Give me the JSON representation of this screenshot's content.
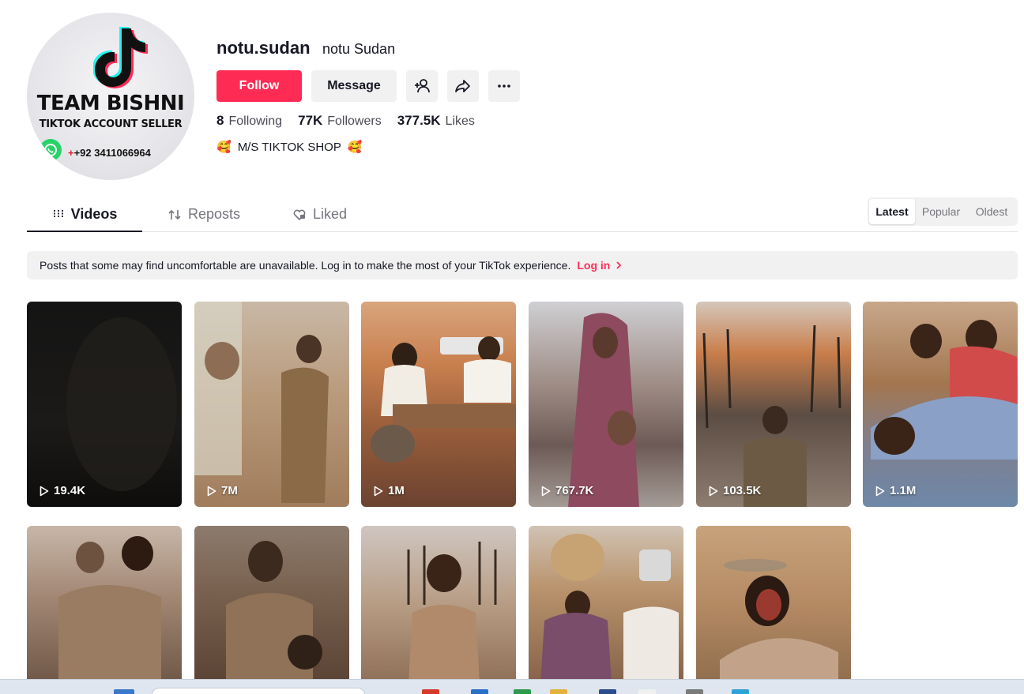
{
  "profile": {
    "username": "notu.sudan",
    "nickname": "notu Sudan",
    "avatar": {
      "title": "TEAM BISHNI",
      "subtitle": "TIKTOK ACCOUNT SELLER",
      "phone_prefix": "+",
      "phone": "+92 3411066964"
    },
    "buttons": {
      "follow": "Follow",
      "message": "Message"
    },
    "stats": {
      "following_count": "8",
      "following_label": "Following",
      "followers_count": "77K",
      "followers_label": "Followers",
      "likes_count": "377.5K",
      "likes_label": "Likes"
    },
    "bio_emoji_left": "🥰",
    "bio": "M/S TIKTOK SHOP",
    "bio_emoji_right": "🥰"
  },
  "tabs": {
    "videos": "Videos",
    "reposts": "Reposts",
    "liked": "Liked"
  },
  "sort": {
    "latest": "Latest",
    "popular": "Popular",
    "oldest": "Oldest",
    "selected": "Latest"
  },
  "notice": {
    "text": "Posts that some may find uncomfortable are unavailable. Log in to make the most of your TikTok experience.",
    "login": "Log in"
  },
  "videos": [
    {
      "views": "19.4K"
    },
    {
      "views": "7M"
    },
    {
      "views": "1M"
    },
    {
      "views": "767.7K"
    },
    {
      "views": "103.5K"
    },
    {
      "views": "1.1M"
    },
    {
      "views": ""
    },
    {
      "views": ""
    },
    {
      "views": ""
    },
    {
      "views": ""
    },
    {
      "views": ""
    }
  ],
  "colors": {
    "accent": "#fe2c55",
    "text": "#161823",
    "muted": "#75767d",
    "button_bg": "#f1f1f2"
  }
}
